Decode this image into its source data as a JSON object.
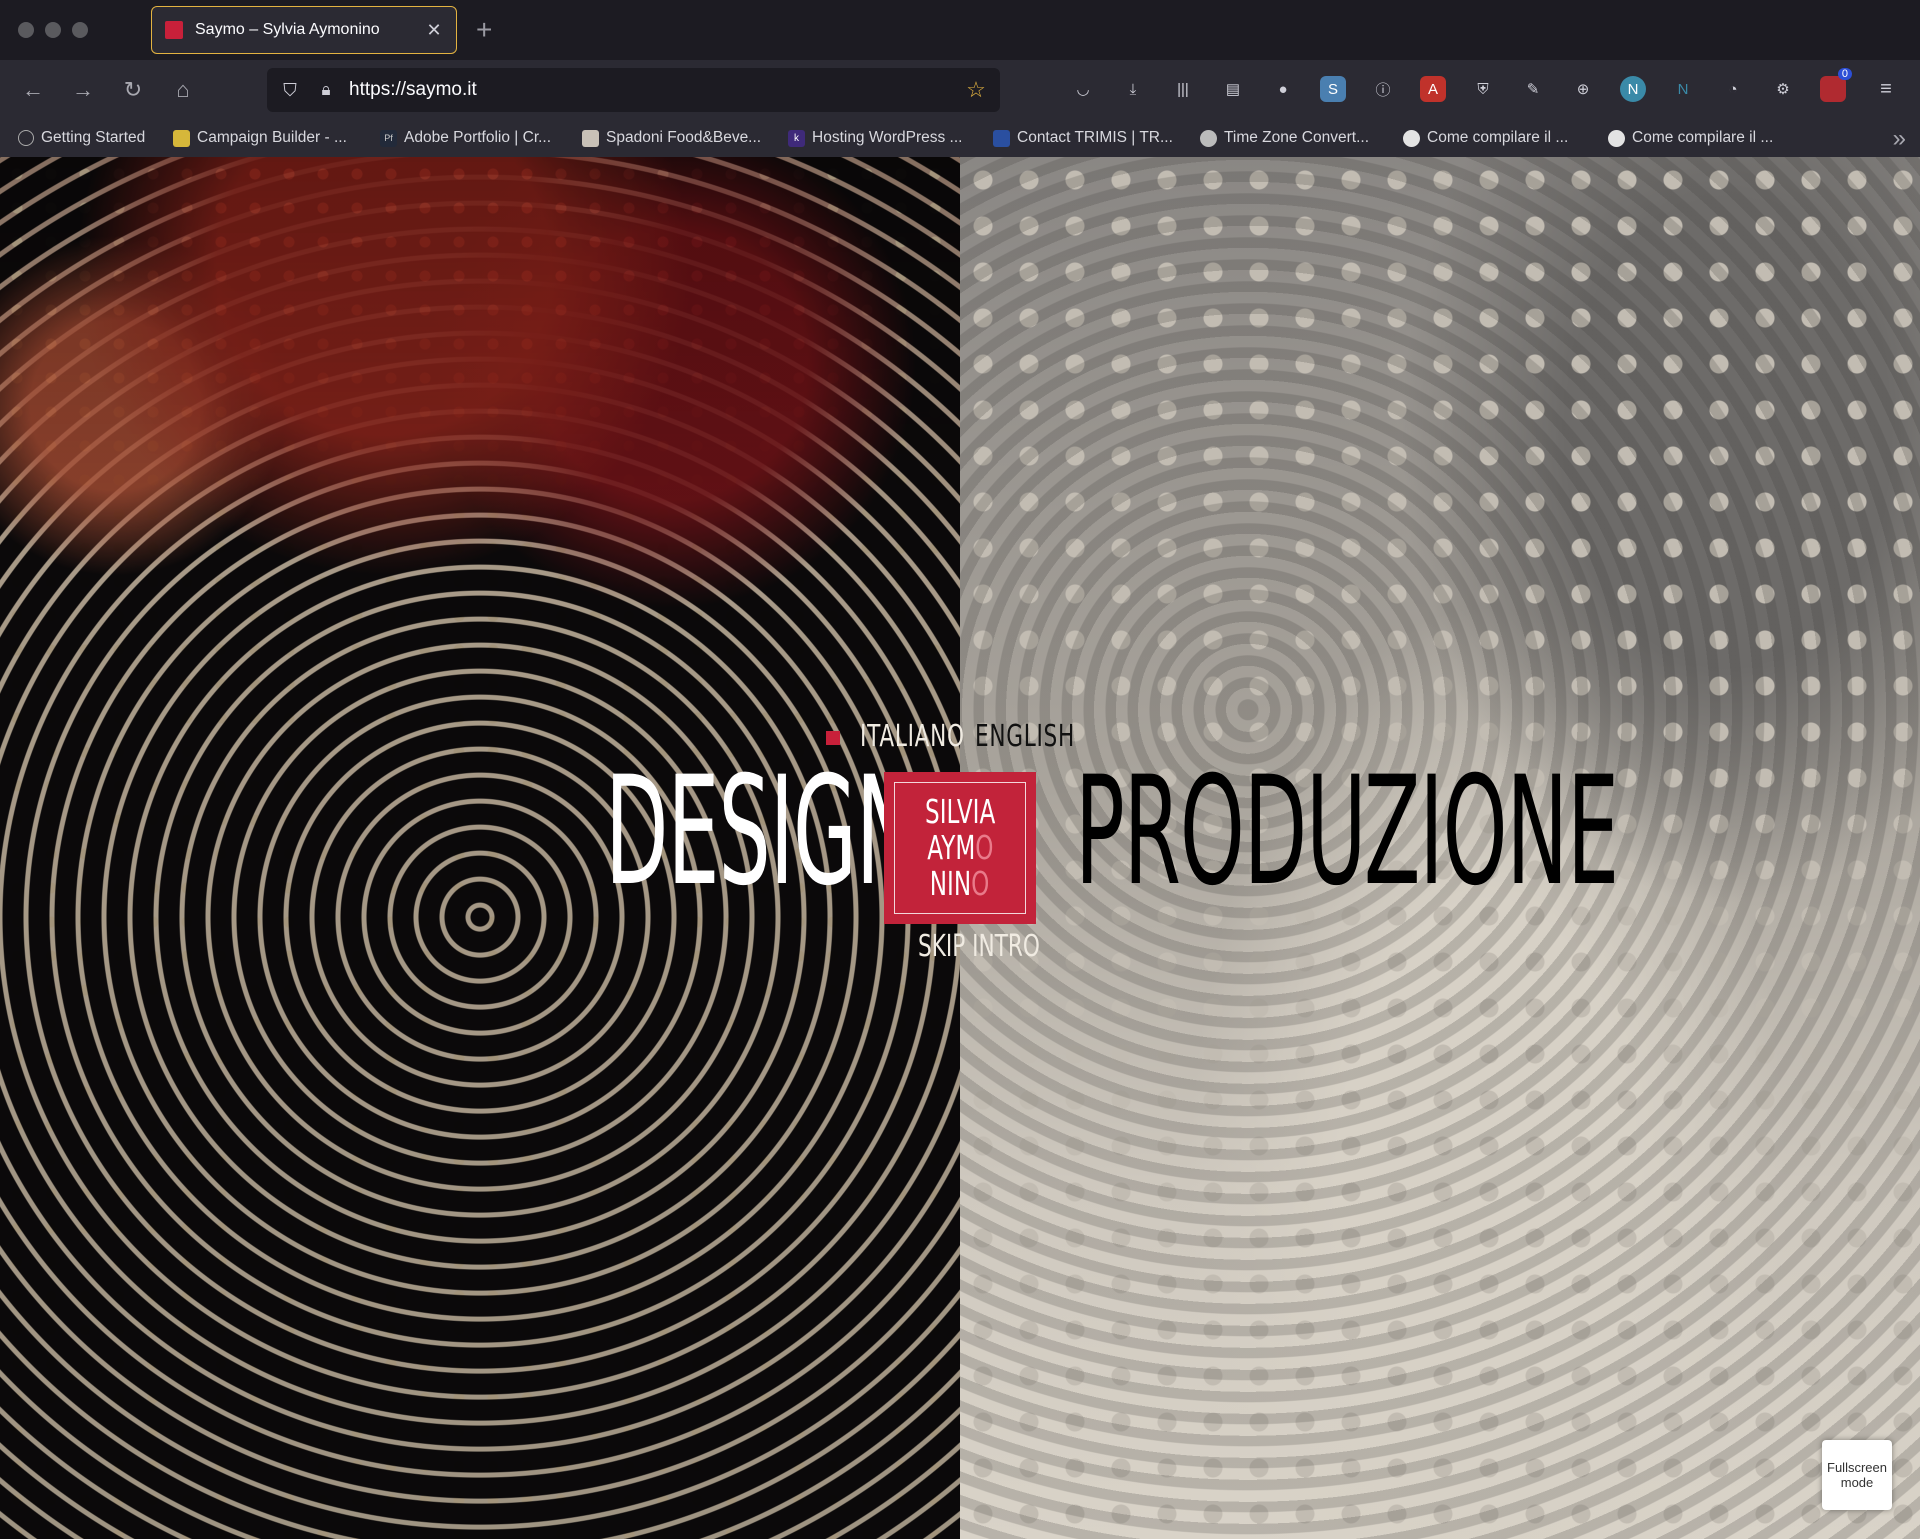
{
  "browser": {
    "tab_title": "Saymo – Sylvia Aymonino",
    "url": "https://saymo.it",
    "bookmarks": [
      "Getting Started",
      "Campaign Builder - ...",
      "Adobe Portfolio | Cr...",
      "Spadoni Food&Beve...",
      "Hosting WordPress ...",
      "Contact TRIMIS | TR...",
      "Time Zone Convert...",
      "Come compilare il ...",
      "Come compilare il ..."
    ],
    "extension_badge": "0",
    "icons": {
      "back": "back-arrow-icon",
      "forward": "forward-arrow-icon",
      "reload": "reload-icon",
      "home": "home-icon",
      "shield": "tracking-shield-icon",
      "lock": "lock-icon",
      "bookmark_star": "bookmark-star-icon",
      "menu": "hamburger-menu-icon"
    },
    "colors": {
      "tab_accent": "#e3b341",
      "chrome_bg": "#2b2a33",
      "frame_bg": "#1c1b22"
    }
  },
  "site": {
    "languages": {
      "italian": "ITALIANO",
      "english": "ENGLISH"
    },
    "left_word": "DESIGN",
    "right_word": "PRODUZIONE",
    "logo": {
      "line1": "SILVIA",
      "line2a": "AYM",
      "line2b": "O",
      "line3a": "NIN",
      "line3b": "O"
    },
    "skip_intro": "SKIP INTRO",
    "fullscreen_button": "Fullscreen mode",
    "colors": {
      "brand_red": "#c2233a",
      "left_text": "#ffffff",
      "right_text": "#000000"
    }
  }
}
